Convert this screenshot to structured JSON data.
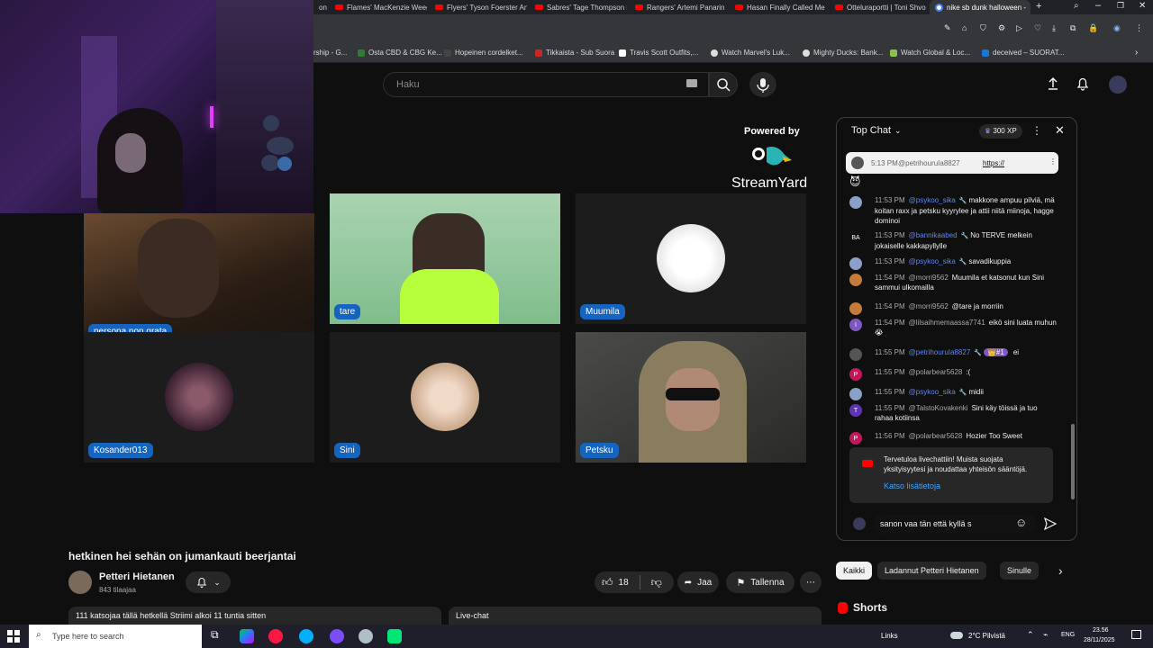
{
  "browser": {
    "tabs": [
      {
        "label": "on"
      },
      {
        "label": "Flames' MacKenzie Weeg"
      },
      {
        "label": "Flyers' Tyson Foerster Anc"
      },
      {
        "label": "Sabres' Tage Thompson li"
      },
      {
        "label": "Rangers' Artemi Panarin li"
      },
      {
        "label": "Hasan Finally Called Me C"
      },
      {
        "label": "Otteluraportti | Toni Shvo"
      },
      {
        "label": "nike sb dunk halloween -"
      }
    ],
    "bookmarks": [
      {
        "label": "rship - G..."
      },
      {
        "label": "Osta CBD & CBG Ke..."
      },
      {
        "label": "Hopeinen cordelket..."
      },
      {
        "label": "Tikkaista - Sub Suora"
      },
      {
        "label": "Travis Scott Outfits,..."
      },
      {
        "label": "Watch Marvel's Luk..."
      },
      {
        "label": "Mighty Ducks: Bank..."
      },
      {
        "label": "Watch Global & Loc..."
      },
      {
        "label": "deceived – SUORAT..."
      }
    ]
  },
  "search": {
    "placeholder": "Haku"
  },
  "stream": {
    "powered_by": "Powered by",
    "brand": "StreamYard",
    "participants": [
      {
        "name": "persona non grata"
      },
      {
        "name": "tare"
      },
      {
        "name": "Muumila"
      },
      {
        "name": "Kosander013"
      },
      {
        "name": "Sini"
      },
      {
        "name": "Petsku"
      }
    ]
  },
  "video": {
    "title": "hetkinen hei sehän on jumankauti beerjantai",
    "channel": "Petteri Hietanen",
    "subscribers": "843 tilaajaa",
    "likes": "18",
    "share_label": "Jaa",
    "save_label": "Tallenna",
    "description": "111 katsojaa tällä hetkellä  Striimi alkoi 11 tuntia sitten",
    "livechat_label": "Live-chat"
  },
  "chat": {
    "mode_label": "Top Chat",
    "xp_label": "300 XP",
    "pinned": {
      "time": "5:13 PM",
      "author": "@petrihouruIa8827",
      "text": "https://"
    },
    "messages": [
      {
        "time": "11:53 PM",
        "author": "@psykoo_sika",
        "text": "makkone ampuu pilviä, mä koitan raxx ja petsku kyyrylee ja attii niitä miinoja, hagge dominoi",
        "avatar_color": "#8aa0c8",
        "initial": "",
        "mod": true
      },
      {
        "time": "11:53 PM",
        "author": "@bannikaabed",
        "text": "No TERVE melkein jokaiselle kakkapyllylle",
        "avatar_color": "#0f0f0f",
        "initial": "BA",
        "mod": true
      },
      {
        "time": "11:53 PM",
        "author": "@psykoo_sika",
        "text": "savadikuppia",
        "avatar_color": "#8aa0c8",
        "initial": "",
        "mod": true
      },
      {
        "time": "11:54 PM",
        "author": "@morri9562",
        "text": "Muumila et katsonut kun Sini sammui ulkomailla",
        "avatar_color": "#c47a3a",
        "initial": "",
        "mod": false
      },
      {
        "time": "11:54 PM",
        "author": "@morri9562",
        "text": "@tare ja morriin",
        "avatar_color": "#c47a3a",
        "initial": "",
        "mod": false
      },
      {
        "time": "11:54 PM",
        "author": "@lilsaihmemaassa7741",
        "text": "eikö sini luata muhun 😭",
        "avatar_color": "#7e57c2",
        "initial": "I",
        "mod": false
      },
      {
        "time": "11:55 PM",
        "author": "@petrihouruIa8827",
        "text": "ei",
        "badge": "👑#1",
        "avatar_color": "#555",
        "initial": "",
        "mod": true
      },
      {
        "time": "11:55 PM",
        "author": "@polarbear5628",
        "text": ":(",
        "avatar_color": "#c2185b",
        "initial": "P",
        "mod": false
      },
      {
        "time": "11:55 PM",
        "author": "@psykoo_sika",
        "text": "midii",
        "avatar_color": "#8aa0c8",
        "initial": "",
        "mod": true
      },
      {
        "time": "11:55 PM",
        "author": "@TalstoKovakenki",
        "text": "Sini käy töissä ja tuo rahaa kotiinsa",
        "avatar_color": "#5e35b1",
        "initial": "T",
        "mod": false
      },
      {
        "time": "11:56 PM",
        "author": "@polarbear5628",
        "text": "Hozier Too Sweet",
        "avatar_color": "#c2185b",
        "initial": "P",
        "mod": false
      }
    ],
    "welcome": "Tervetuloa livechattiin! Muista suojata yksityisyytesi ja noudattaa yhteisön sääntöjä.",
    "welcome_link": "Katso lisätietoja",
    "input_value": "sanon vaa tän että kyllä s"
  },
  "chips": [
    {
      "label": "Kaikki"
    },
    {
      "label": "Ladannut Petteri Hietanen"
    },
    {
      "label": "Sinulle"
    }
  ],
  "shorts": {
    "label": "Shorts"
  },
  "taskbar": {
    "search_placeholder": "Type here to search",
    "links": "Links",
    "weather": "2°C  Pilvistä",
    "lang": "ENG",
    "time": "23.56",
    "date": "28/11/2025"
  }
}
